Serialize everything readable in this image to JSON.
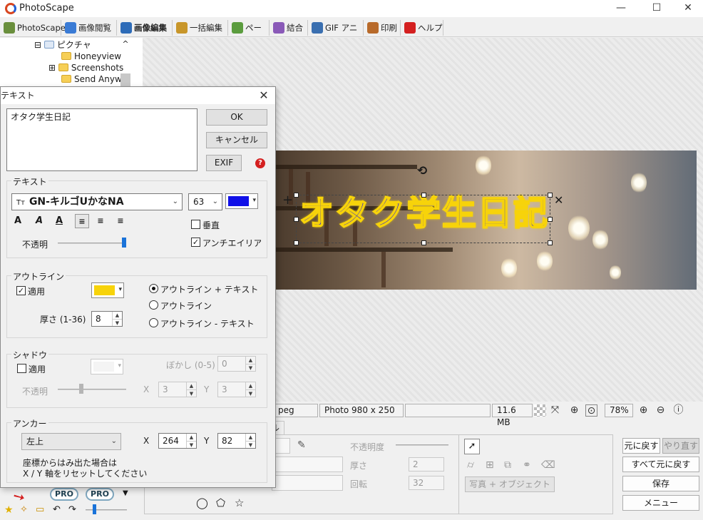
{
  "app": {
    "title": "PhotoScape"
  },
  "window_controls": {
    "minimize": "—",
    "maximize": "☐",
    "close": "✕"
  },
  "tabs": [
    {
      "label": "PhotoScape",
      "color": "#6a8f3d"
    },
    {
      "label": "画像閲覧",
      "color": "#3a7bd5"
    },
    {
      "label": "画像編集",
      "color": "#2e6cb8"
    },
    {
      "label": "一括編集",
      "color": "#c8962a"
    },
    {
      "label": "ページ",
      "color": "#5b9c3e"
    },
    {
      "label": "結合",
      "color": "#8a5ab8"
    },
    {
      "label": "GIF アニメ",
      "color": "#3a6fb0"
    },
    {
      "label": "印刷",
      "color": "#b86a2a"
    },
    {
      "label": "ヘルプ",
      "color": "#d42020"
    }
  ],
  "tree": {
    "items": [
      {
        "label": "ピクチャ",
        "expander": "⊟"
      },
      {
        "label": "Honeyview"
      },
      {
        "label": "Screenshots",
        "expander": "⊞"
      },
      {
        "label": "Send Anyw"
      }
    ],
    "scroll_up": "^"
  },
  "canvas": {
    "overlay_text": "オタク学生日記",
    "rotate_glyph": "⟲",
    "move_glyph": "+",
    "delete_glyph": "✕"
  },
  "status": {
    "filetype": "peg",
    "dimensions": "Photo 980 x 250",
    "filesize": "11.6 MB",
    "zoom": "78%"
  },
  "bottom_panel": {
    "tab_label": "ル",
    "opacity_label": "不透明度",
    "thickness_label": "厚さ",
    "thickness_value": "2",
    "rotation_label": "回転",
    "rotation_value": "32",
    "photo_object_label": "写真 + オブジェクト"
  },
  "right_buttons": {
    "undo": "元に戻す",
    "redo": "やり直す",
    "undo_all": "すべて元に戻す",
    "save": "保存",
    "menu": "メニュー"
  },
  "left_tools": {
    "pro1": "PRO",
    "pro2": "PRO"
  },
  "dialog": {
    "title": "テキスト",
    "close": "✕",
    "text_value": "オタク学生日記",
    "ok": "OK",
    "cancel": "キャンセル",
    "exif": "EXIF",
    "help_icon": "?",
    "text_group": {
      "title": "テキスト",
      "font_name": "GN-キルゴUかなNA",
      "font_icon": "Tт",
      "font_size": "63",
      "text_color": "#1010e8",
      "bold_glyph": "A",
      "italic_glyph": "A",
      "underline_glyph": "A",
      "vertical_label": "垂直",
      "antialias_label": "アンチエイリアシン",
      "antialias_check": "✓",
      "opacity_label": "不透明",
      "opacity_value": 1.0
    },
    "outline_group": {
      "title": "アウトライン",
      "apply_label": "適用",
      "apply_check": "✓",
      "color": "#f7d30a",
      "thickness_label": "厚さ (1-36)",
      "thickness_value": "8",
      "options": [
        "アウトライン + テキスト",
        "アウトライン",
        "アウトライン - テキスト"
      ]
    },
    "shadow_group": {
      "title": "シャドウ",
      "apply_label": "適用",
      "blur_label": "ぼかし (0-5)",
      "blur_value": "0",
      "opacity_label": "不透明",
      "x_label": "X",
      "x_value": "3",
      "y_label": "Y",
      "y_value": "3"
    },
    "anchor_group": {
      "title": "アンカー",
      "position": "左上",
      "x_label": "X",
      "x_value": "264",
      "y_label": "Y",
      "y_value": "82",
      "note_line1": "座標からはみ出た場合は",
      "note_line2": "X / Y 軸をリセットしてください"
    }
  }
}
